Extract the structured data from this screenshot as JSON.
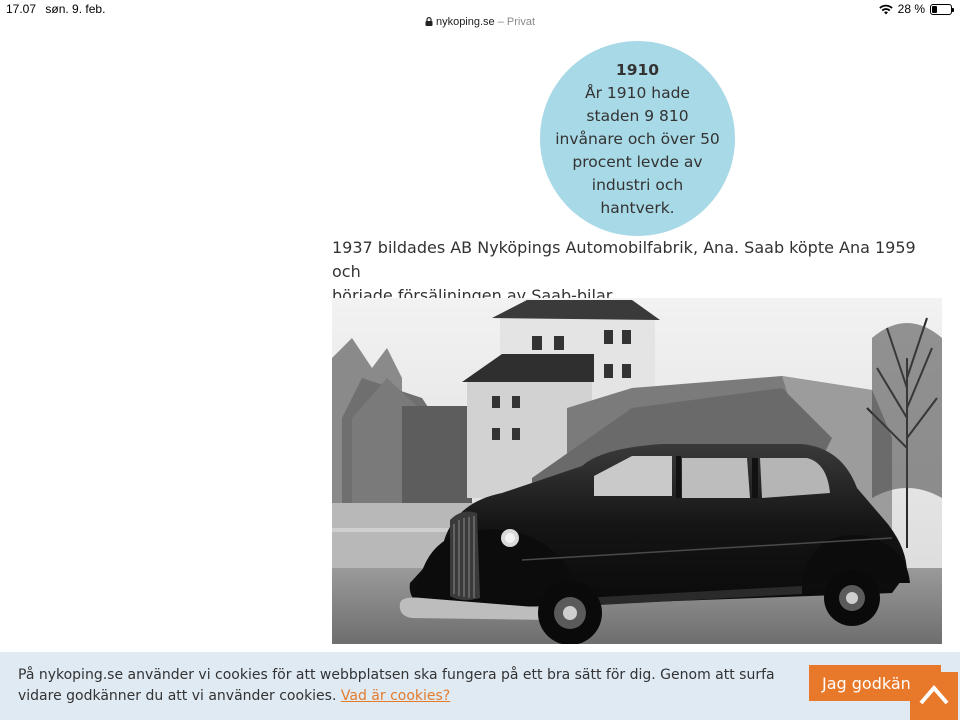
{
  "status_bar": {
    "time": "17.07",
    "date": "søn. 9. feb.",
    "battery_percent": "28 %",
    "battery_level": 0.28
  },
  "url_bar": {
    "domain": "nykoping.se",
    "separator": " – ",
    "mode": "Privat"
  },
  "fact_box": {
    "year": "1910",
    "lines": [
      "År 1910 hade",
      "staden 9 810",
      "invånare och över 50",
      "procent levde av",
      "industri och",
      "hantverk."
    ]
  },
  "article": {
    "lines": [
      "1937 bildades AB Nyköpings Automobilfabrik, Ana. Saab köpte Ana 1959 och",
      "började försäljningen av Saab-bilar."
    ]
  },
  "cookie_banner": {
    "text_line1": "På nykoping.se använder vi cookies för att webbplatsen ska fungera på ett bra sätt för dig. Genom att surfa",
    "text_line2": "vidare godkänner du att vi använder cookies. ",
    "link_label": "Vad är cookies?",
    "accept_label": "Jag godkänner",
    "link_color": "#e57b2c",
    "button_color": "#e8782a"
  },
  "icons": {
    "wifi": "wifi-icon",
    "battery": "battery-icon",
    "lock": "lock-icon",
    "scroll_top": "chevron-up-icon"
  }
}
